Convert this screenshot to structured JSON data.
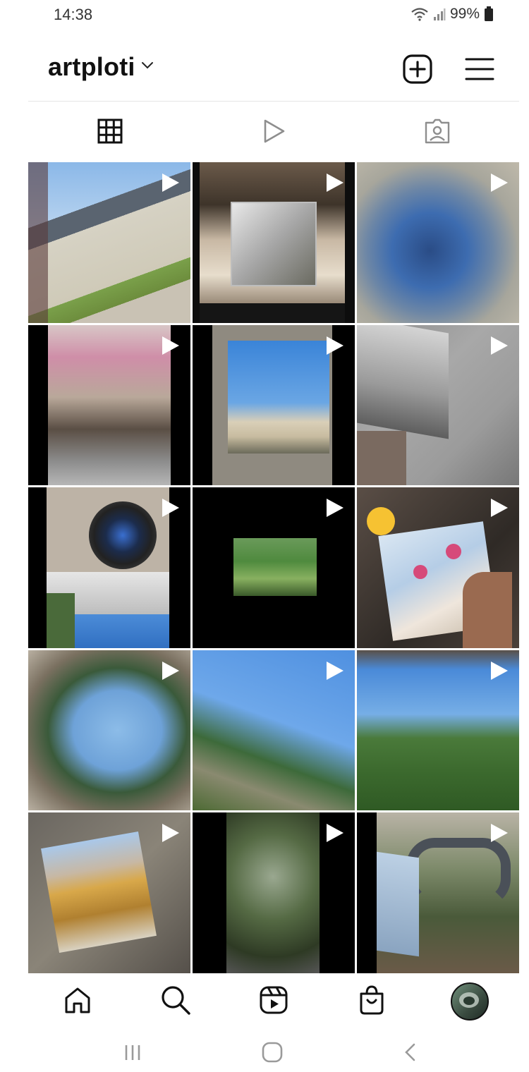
{
  "status_bar": {
    "time": "14:38",
    "battery": "99%",
    "icons": [
      "wifi-icon",
      "signal-icon",
      "battery-icon"
    ]
  },
  "header": {
    "username": "artploti",
    "dropdown_icon": "chevron-down-icon",
    "new_post_icon": "plus-square-icon",
    "menu_icon": "hamburger-menu-icon"
  },
  "tabs": [
    {
      "name": "grid",
      "icon": "grid-icon",
      "active": true
    },
    {
      "name": "reels",
      "icon": "reels-play-icon",
      "active": false
    },
    {
      "name": "tagged",
      "icon": "tagged-person-icon",
      "active": false
    }
  ],
  "grid": {
    "tiles": [
      {
        "type": "reel",
        "overlay_icon": "reel-play-icon"
      },
      {
        "type": "reel",
        "overlay_icon": "reel-play-icon"
      },
      {
        "type": "reel",
        "overlay_icon": "reel-play-icon"
      },
      {
        "type": "reel",
        "overlay_icon": "reel-play-icon"
      },
      {
        "type": "reel",
        "overlay_icon": "reel-play-icon"
      },
      {
        "type": "reel",
        "overlay_icon": "reel-play-icon"
      },
      {
        "type": "reel",
        "overlay_icon": "reel-play-icon"
      },
      {
        "type": "reel",
        "overlay_icon": "reel-play-icon"
      },
      {
        "type": "reel",
        "overlay_icon": "reel-play-icon"
      },
      {
        "type": "reel",
        "overlay_icon": "reel-play-icon"
      },
      {
        "type": "reel",
        "overlay_icon": "reel-play-icon"
      },
      {
        "type": "reel",
        "overlay_icon": "reel-play-icon"
      },
      {
        "type": "reel",
        "overlay_icon": "reel-play-icon"
      },
      {
        "type": "reel",
        "overlay_icon": "reel-play-icon"
      },
      {
        "type": "reel",
        "overlay_icon": "reel-play-icon"
      }
    ]
  },
  "bottom_nav": [
    {
      "name": "home",
      "icon": "home-icon"
    },
    {
      "name": "search",
      "icon": "search-icon"
    },
    {
      "name": "reels",
      "icon": "reels-icon"
    },
    {
      "name": "shop",
      "icon": "shop-bag-icon"
    },
    {
      "name": "profile",
      "icon": "profile-avatar"
    }
  ],
  "system_nav": [
    {
      "name": "recents",
      "icon": "recents-icon"
    },
    {
      "name": "home",
      "icon": "home-circle-icon"
    },
    {
      "name": "back",
      "icon": "back-chevron-icon"
    }
  ],
  "colors": {
    "text": "#111111",
    "divider": "#e6e6e6",
    "inactive_icon": "#8e8e8e",
    "system_icon": "#9a9a9a"
  }
}
